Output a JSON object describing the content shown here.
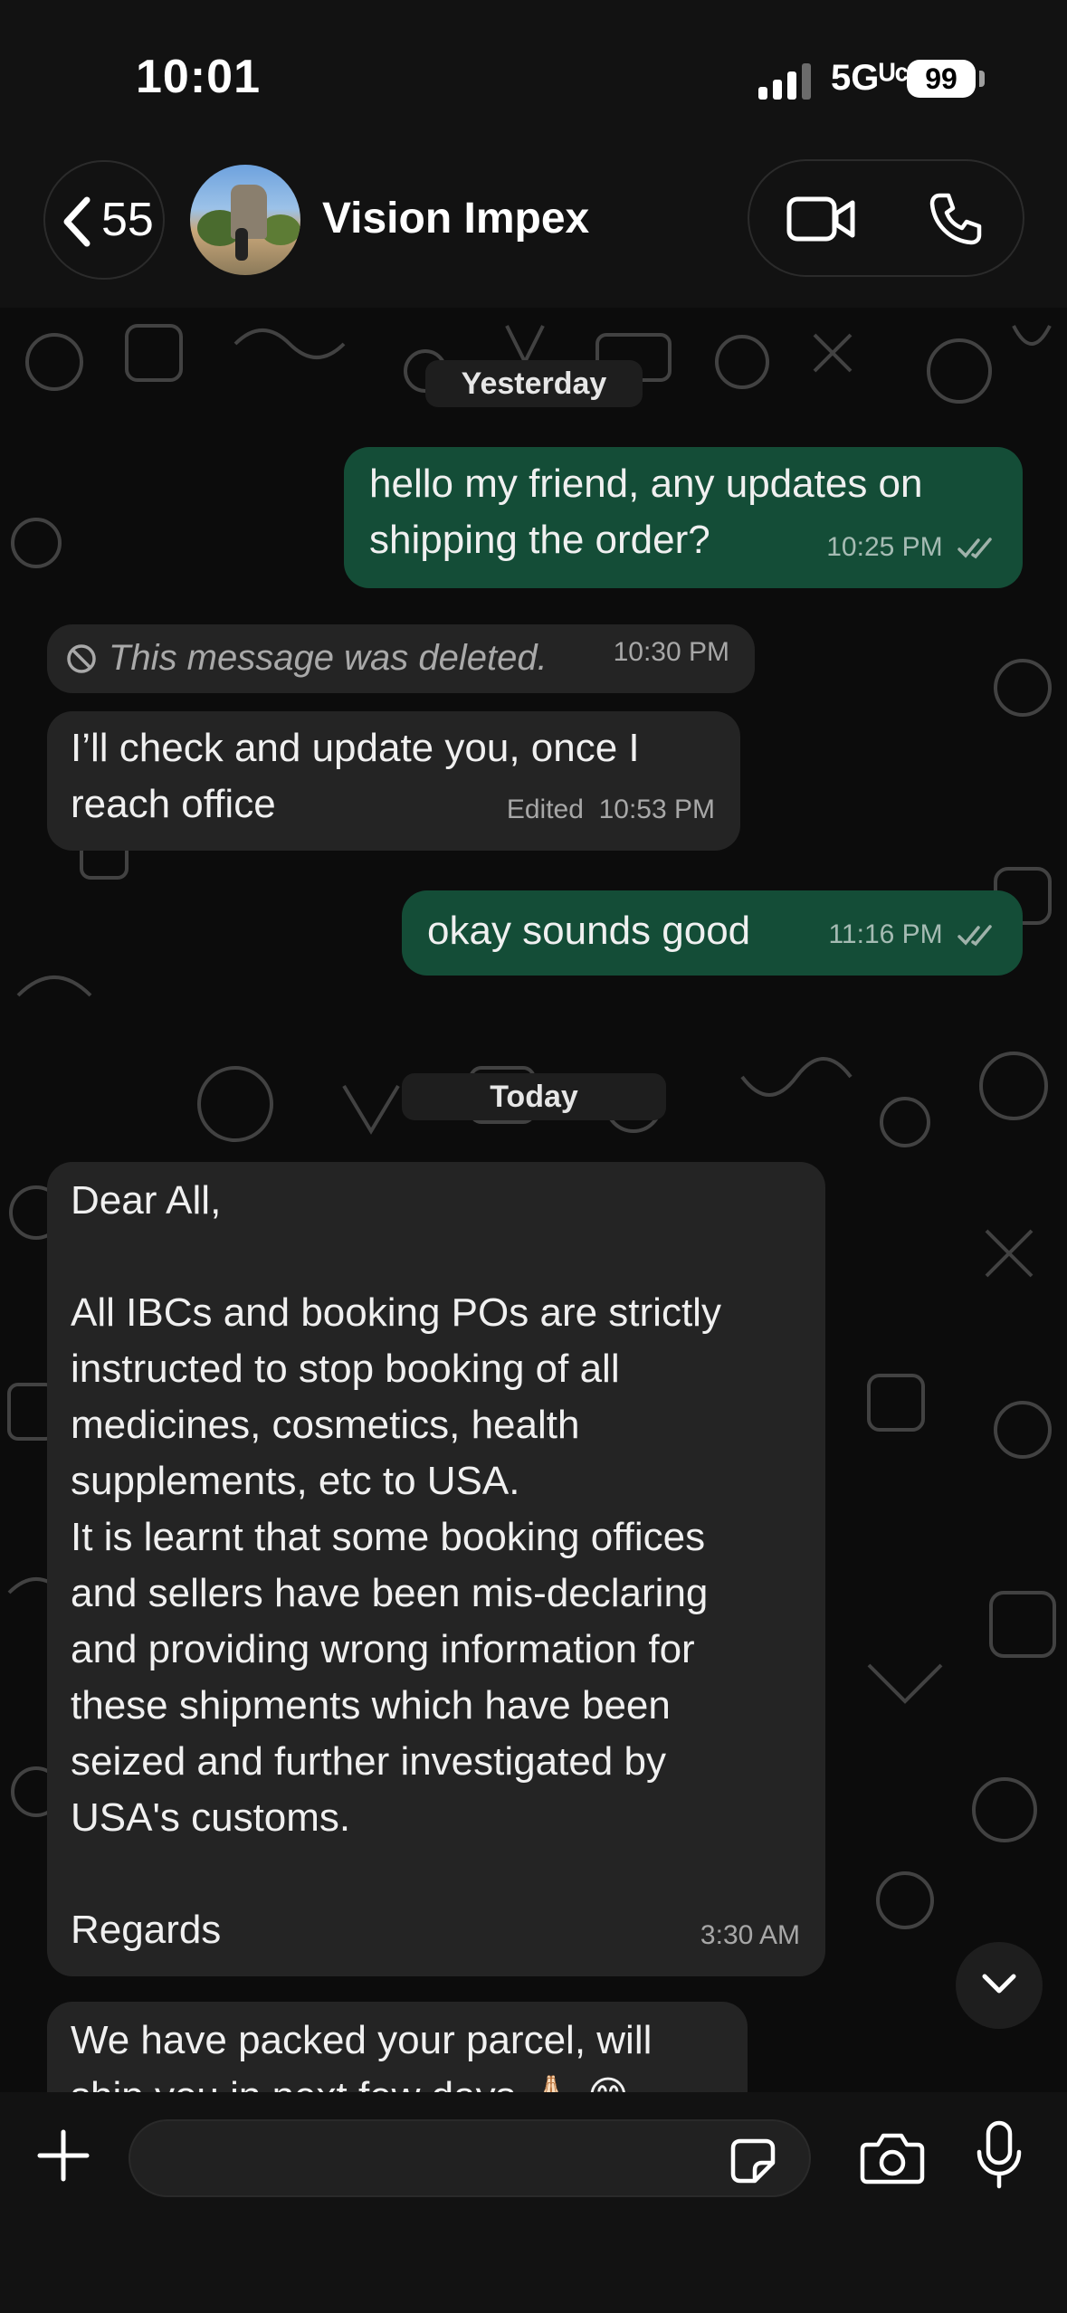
{
  "status_bar": {
    "time": "10:01",
    "network": "5Gᵁᶜ",
    "battery": "99"
  },
  "header": {
    "back_count": "55",
    "contact_name": "Vision Impex"
  },
  "messages": [
    {
      "type": "date",
      "label": "Yesterday"
    },
    {
      "type": "out",
      "text": "hello my friend, any updates on\nshipping the order?",
      "time": "10:25 PM",
      "read": true
    },
    {
      "type": "deleted",
      "text": "This message was deleted.",
      "time": "10:30 PM"
    },
    {
      "type": "in",
      "text": "I’ll check and update you, once I\nreach office",
      "edited": "Edited",
      "time": "10:53 PM"
    },
    {
      "type": "out",
      "text": "okay sounds good",
      "time": "11:16 PM",
      "read": true
    },
    {
      "type": "date",
      "label": "Today"
    },
    {
      "type": "in",
      "text": "Dear All,\n\nAll IBCs and booking POs are strictly\ninstructed to stop booking of all\nmedicines, cosmetics, health\nsupplements, etc to USA.\nIt is learnt that some booking offices\nand sellers have been mis-declaring\nand providing wrong information for\nthese shipments which have been\nseized and further investigated by\nUSA's customs.\n\nRegards",
      "time": "3:30 AM"
    },
    {
      "type": "in",
      "text": "We have packed your parcel, will\nship you in next few days 🙏🏻 😊"
    }
  ],
  "composer": {
    "placeholder": ""
  },
  "colors": {
    "outgoing_bubble": "#144d37",
    "incoming_bubble": "#242424",
    "read_ticks": "#9fb2aa"
  }
}
